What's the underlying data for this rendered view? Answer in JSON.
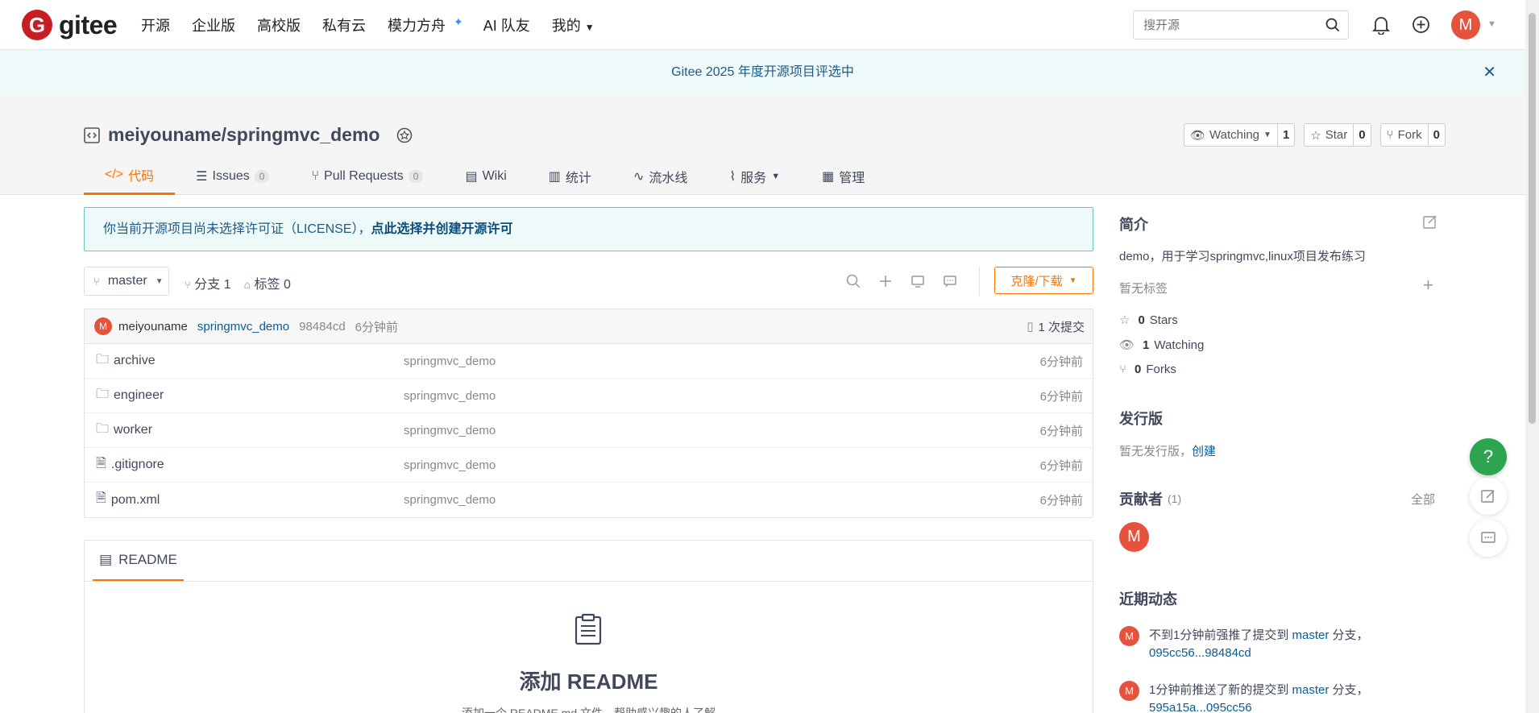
{
  "header": {
    "logo_text": "gitee",
    "logo_letter": "G",
    "nav": [
      "开源",
      "企业版",
      "高校版",
      "私有云",
      "模力方舟",
      "AI 队友",
      "我的"
    ],
    "search_placeholder": "搜开源",
    "avatar_letter": "M"
  },
  "banner": {
    "text": "Gitee 2025 年度开源项目评选中"
  },
  "repo": {
    "title": "meiyouname/springmvc_demo",
    "watch_label": "Watching",
    "watch_count": "1",
    "star_label": "Star",
    "star_count": "0",
    "fork_label": "Fork",
    "fork_count": "0",
    "tabs": [
      {
        "label": "代码",
        "count": null
      },
      {
        "label": "Issues",
        "count": "0"
      },
      {
        "label": "Pull Requests",
        "count": "0"
      },
      {
        "label": "Wiki",
        "count": null
      },
      {
        "label": "统计",
        "count": null
      },
      {
        "label": "流水线",
        "count": null
      },
      {
        "label": "服务",
        "count": null
      },
      {
        "label": "管理",
        "count": null
      }
    ]
  },
  "license": {
    "text": "你当前开源项目尚未选择许可证（LICENSE），",
    "link": "点此选择并创建开源许可"
  },
  "branch": {
    "name": "master",
    "branches": "分支 1",
    "tags": "标签 0",
    "clone_label": "克隆/下载"
  },
  "commit": {
    "avatar_letter": "M",
    "author": "meiyouname",
    "message": "springmvc_demo",
    "sha": "98484cd",
    "time": "6分钟前",
    "count": "1 次提交"
  },
  "files": [
    {
      "name": "archive",
      "type": "folder",
      "message": "springmvc_demo",
      "time": "6分钟前"
    },
    {
      "name": "engineer",
      "type": "folder",
      "message": "springmvc_demo",
      "time": "6分钟前"
    },
    {
      "name": "worker",
      "type": "folder",
      "message": "springmvc_demo",
      "time": "6分钟前"
    },
    {
      "name": ".gitignore",
      "type": "file",
      "message": "springmvc_demo",
      "time": "6分钟前"
    },
    {
      "name": "pom.xml",
      "type": "file",
      "message": "springmvc_demo",
      "time": "6分钟前"
    }
  ],
  "readme": {
    "tab": "README",
    "title": "添加 README",
    "subtitle": "添加一个 README.md 文件，帮助感兴趣的人了解"
  },
  "sidebar": {
    "intro_title": "简介",
    "intro_text": "demo，用于学习springmvc,linux项目发布练习",
    "no_tags": "暂无标签",
    "stars_count": "0",
    "stars_label": "Stars",
    "watching_count": "1",
    "watching_label": "Watching",
    "forks_count": "0",
    "forks_label": "Forks",
    "release_title": "发行版",
    "release_text": "暂无发行版，",
    "release_link": "创建",
    "contrib_title": "贡献者",
    "contrib_count": "(1)",
    "contrib_all": "全部",
    "contrib_avatar": "M",
    "activity_title": "近期动态",
    "activities": [
      {
        "avatar": "M",
        "prefix": "不到1分钟前强推了提交到 ",
        "branch": "master",
        "mid": " 分支，",
        "link": "095cc56...98484cd"
      },
      {
        "avatar": "M",
        "prefix": "1分钟前推送了新的提交到 ",
        "branch": "master",
        "mid": " 分支，",
        "link": "595a15a...095cc56"
      }
    ]
  },
  "floating": {
    "help": "?"
  }
}
